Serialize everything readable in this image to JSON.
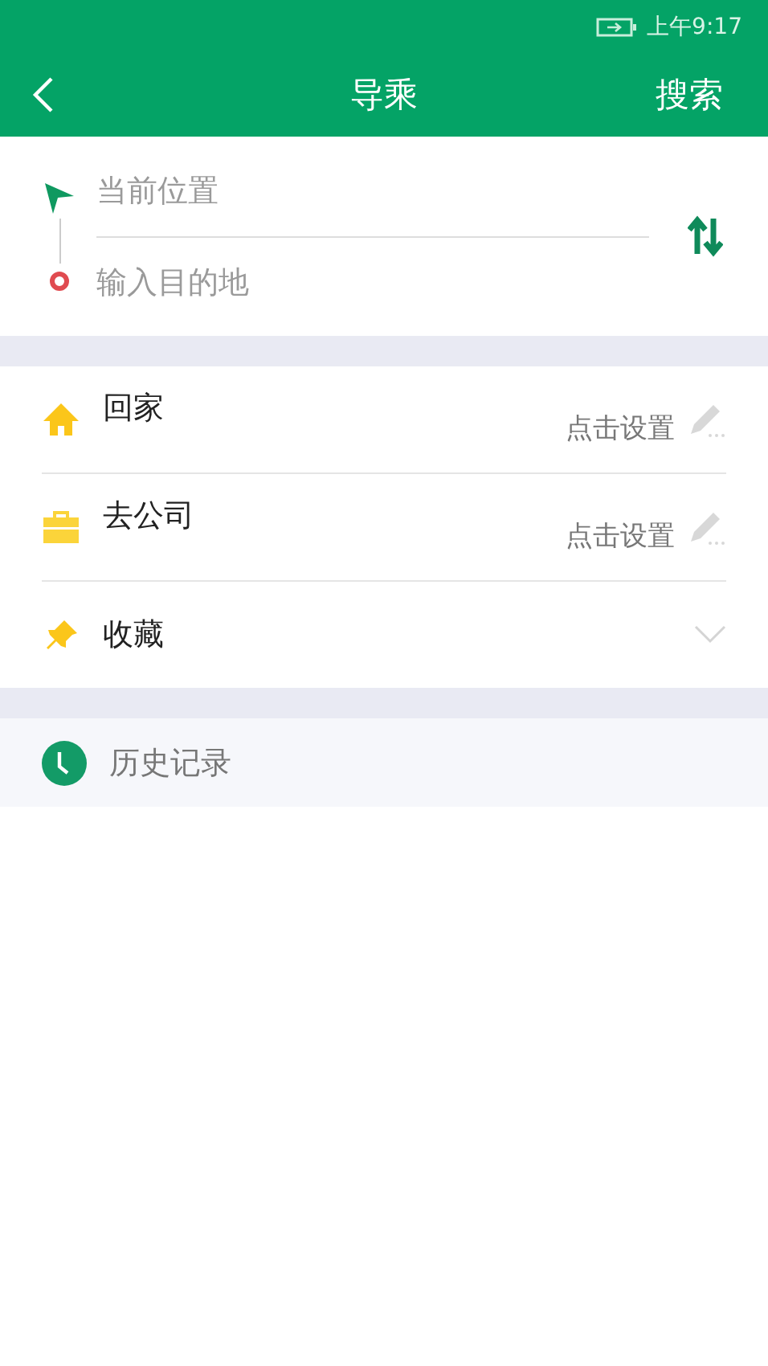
{
  "status_bar": {
    "time": "上午9:17"
  },
  "header": {
    "title": "导乘",
    "action": "搜索"
  },
  "route": {
    "origin": {
      "placeholder": "当前位置"
    },
    "destination": {
      "placeholder": "输入目的地"
    }
  },
  "places": [
    {
      "kind": "home",
      "label": "回家",
      "action": "点击设置"
    },
    {
      "kind": "work",
      "label": "去公司",
      "action": "点击设置"
    },
    {
      "kind": "favorites",
      "label": "收藏",
      "expanded": false
    }
  ],
  "history": {
    "label": "历史记录"
  }
}
